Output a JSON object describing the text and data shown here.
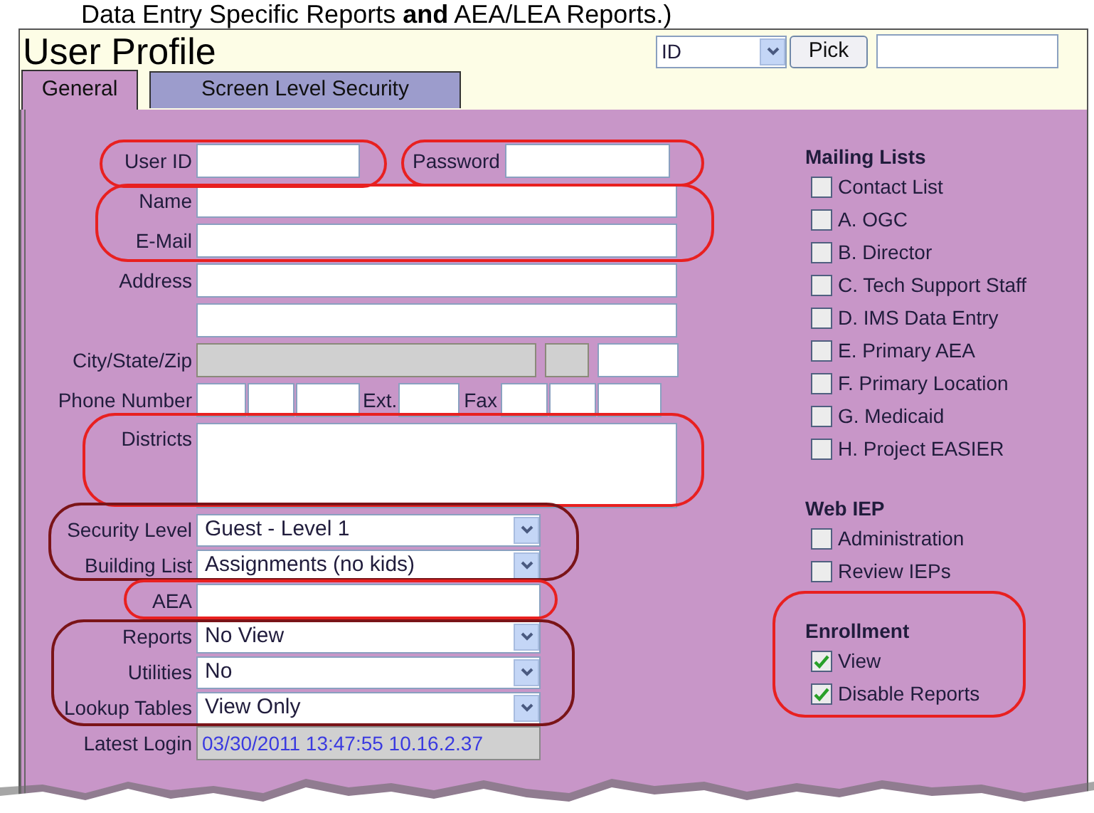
{
  "caption": "Data Entry Specific Reports **and** AEA/LEA Reports.)",
  "title": "User Profile",
  "picker": {
    "select": "ID",
    "button": "Pick"
  },
  "tabs": [
    {
      "label": "General",
      "selected": true
    },
    {
      "label": "Screen Level Security",
      "selected": false
    }
  ],
  "form": [
    {
      "kind": "pair",
      "label": "User ID",
      "second_label": "Password"
    },
    {
      "kind": "text",
      "label": "Name"
    },
    {
      "kind": "text",
      "label": "E-Mail"
    },
    {
      "kind": "text",
      "label": "Address"
    },
    {
      "kind": "text"
    },
    {
      "kind": "city",
      "label": "City/State/Zip",
      "boxes": [
        {
          "disabled": true
        },
        {
          "disabled": true
        },
        {
          "disabled": false
        }
      ]
    },
    {
      "kind": "phone",
      "label": "Phone Number",
      "ext_label": "Ext.",
      "fax_label": "Fax"
    },
    {
      "kind": "textarea",
      "label": "Districts"
    },
    {
      "kind": "select",
      "label": "Security Level",
      "value": "Guest - Level 1"
    },
    {
      "kind": "select",
      "label": "Building List",
      "value": "Assignments (no kids)"
    },
    {
      "kind": "short_text",
      "label": "AEA"
    },
    {
      "kind": "select",
      "label": "Reports",
      "value": "No View"
    },
    {
      "kind": "select",
      "label": "Utilities",
      "value": "No"
    },
    {
      "kind": "select",
      "label": "Lookup Tables",
      "value": "View Only"
    },
    {
      "kind": "readonly",
      "label": "Latest Login",
      "value": "03/30/2011 13:47:55 10.16.2.37"
    }
  ],
  "groups": [
    {
      "title": "Mailing Lists",
      "items": [
        {
          "label": "Contact List",
          "checked": false
        },
        {
          "label": "A. OGC",
          "checked": false
        },
        {
          "label": "B. Director",
          "checked": false
        },
        {
          "label": "C. Tech Support Staff",
          "checked": false
        },
        {
          "label": "D. IMS Data Entry",
          "checked": false
        },
        {
          "label": "E. Primary AEA",
          "checked": false
        },
        {
          "label": "F. Primary Location",
          "checked": false
        },
        {
          "label": "G. Medicaid",
          "checked": false
        },
        {
          "label": "H. Project EASIER",
          "checked": false
        }
      ]
    },
    {
      "title": "Web IEP",
      "items": [
        {
          "label": "Administration",
          "checked": false
        },
        {
          "label": "Review IEPs",
          "checked": false
        }
      ]
    },
    {
      "title": "Enrollment",
      "items": [
        {
          "label": "View",
          "checked": true
        },
        {
          "label": "Disable Reports",
          "checked": true
        }
      ]
    }
  ],
  "annotations": [
    {
      "color": "#e82020"
    },
    {
      "color": "#e82020"
    },
    {
      "color": "#e82020"
    },
    {
      "color": "#e82020"
    },
    {
      "color": "#7a1418"
    },
    {
      "color": "#e82020"
    },
    {
      "color": "#7a1418"
    },
    {
      "color": "#e82020"
    }
  ]
}
